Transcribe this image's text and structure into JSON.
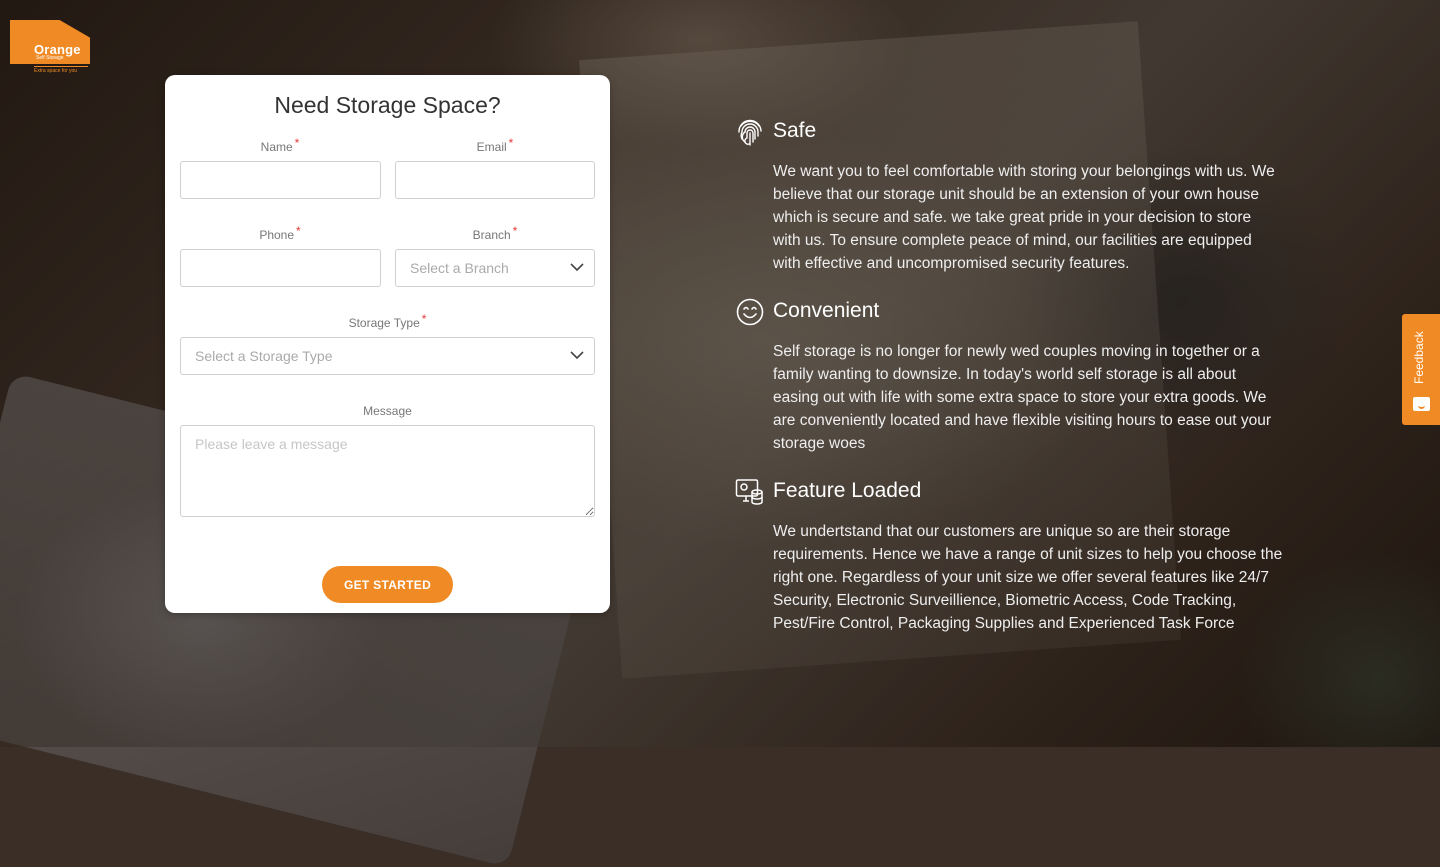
{
  "brand": {
    "name": "Orange",
    "sub": "Self Storage",
    "tagline": "Extra space for you",
    "accent_color": "#f08a24"
  },
  "form": {
    "title": "Need Storage Space?",
    "name_label": "Name",
    "email_label": "Email",
    "phone_label": "Phone",
    "branch_label": "Branch",
    "branch_placeholder": "Select a Branch",
    "storage_type_label": "Storage Type",
    "storage_type_placeholder": "Select a Storage Type",
    "message_label": "Message",
    "message_placeholder": "Please leave a message",
    "required_mark": "*",
    "submit_label": "GET STARTED"
  },
  "features": [
    {
      "icon": "fingerprint-icon",
      "title": "Safe",
      "text": "We want you to feel comfortable with storing your belongings with us. We believe that our storage unit should be an extension of your own house which is secure and safe. we take great pride in your decision to store with us. To ensure complete peace of mind, our facilities are equipped with effective and uncompromised security features."
    },
    {
      "icon": "smiley-icon",
      "title": "Convenient",
      "text": "Self storage is no longer for newly wed couples moving in together or a family wanting to downsize. In today's world self storage is all about easing out with life with some extra space to store your extra goods. We are conveniently located and have flexible visiting hours to ease out your storage woes"
    },
    {
      "icon": "monitor-database-icon",
      "title": "Feature Loaded",
      "text": "We undertstand that our customers are unique so are their storage requirements. Hence we have a range of unit sizes to help you choose the right one. Regardless of your unit size we offer several features like 24/7 Security, Electronic Surveillience, Biometric Access, Code Tracking, Pest/Fire Control, Packaging Supplies and Experienced Task Force"
    }
  ],
  "feedback_tab": {
    "label": "Feedback",
    "icon": "feedback-smile-icon"
  }
}
